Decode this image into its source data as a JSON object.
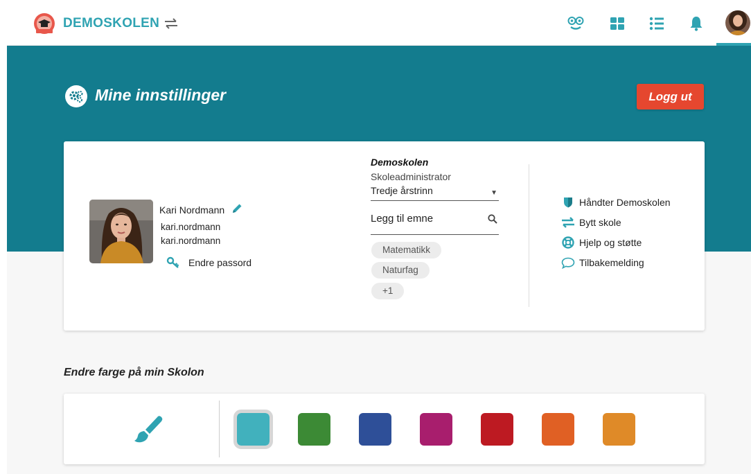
{
  "header": {
    "brand": "DEMOSKOLEN",
    "icons": [
      "teacher-icon",
      "apps-grid-icon",
      "list-icon",
      "bell-icon"
    ],
    "accent": "#2fa3b2"
  },
  "hero": {
    "title": "Mine innstillinger",
    "logout_label": "Logg ut",
    "bg": "#137c8e"
  },
  "profile": {
    "name": "Kari Nordmann",
    "line1": "kari.nordmann",
    "line2": "kari.nordmann",
    "change_password": "Endre passord"
  },
  "school": {
    "name": "Demoskolen",
    "role": "Skoleadministrator",
    "grade": "Tredje årstrinn",
    "subject_placeholder": "Legg til emne",
    "subjects": [
      "Matematikk",
      "Naturfag",
      "+1"
    ]
  },
  "menu": {
    "items": [
      {
        "label": "Håndter Demoskolen",
        "icon": "shield-icon"
      },
      {
        "label": "Bytt skole",
        "icon": "swap-icon"
      },
      {
        "label": "Hjelp og støtte",
        "icon": "lifebuoy-icon"
      },
      {
        "label": "Tilbakemelding",
        "icon": "speech-bubble-icon"
      }
    ]
  },
  "colors": {
    "title": "Endre farge på min Skolon",
    "selected": 0,
    "swatches": [
      "#41b1bd",
      "#3c8a35",
      "#2e4f98",
      "#a81e6d",
      "#bd1a22",
      "#e06024",
      "#df8a28"
    ]
  }
}
